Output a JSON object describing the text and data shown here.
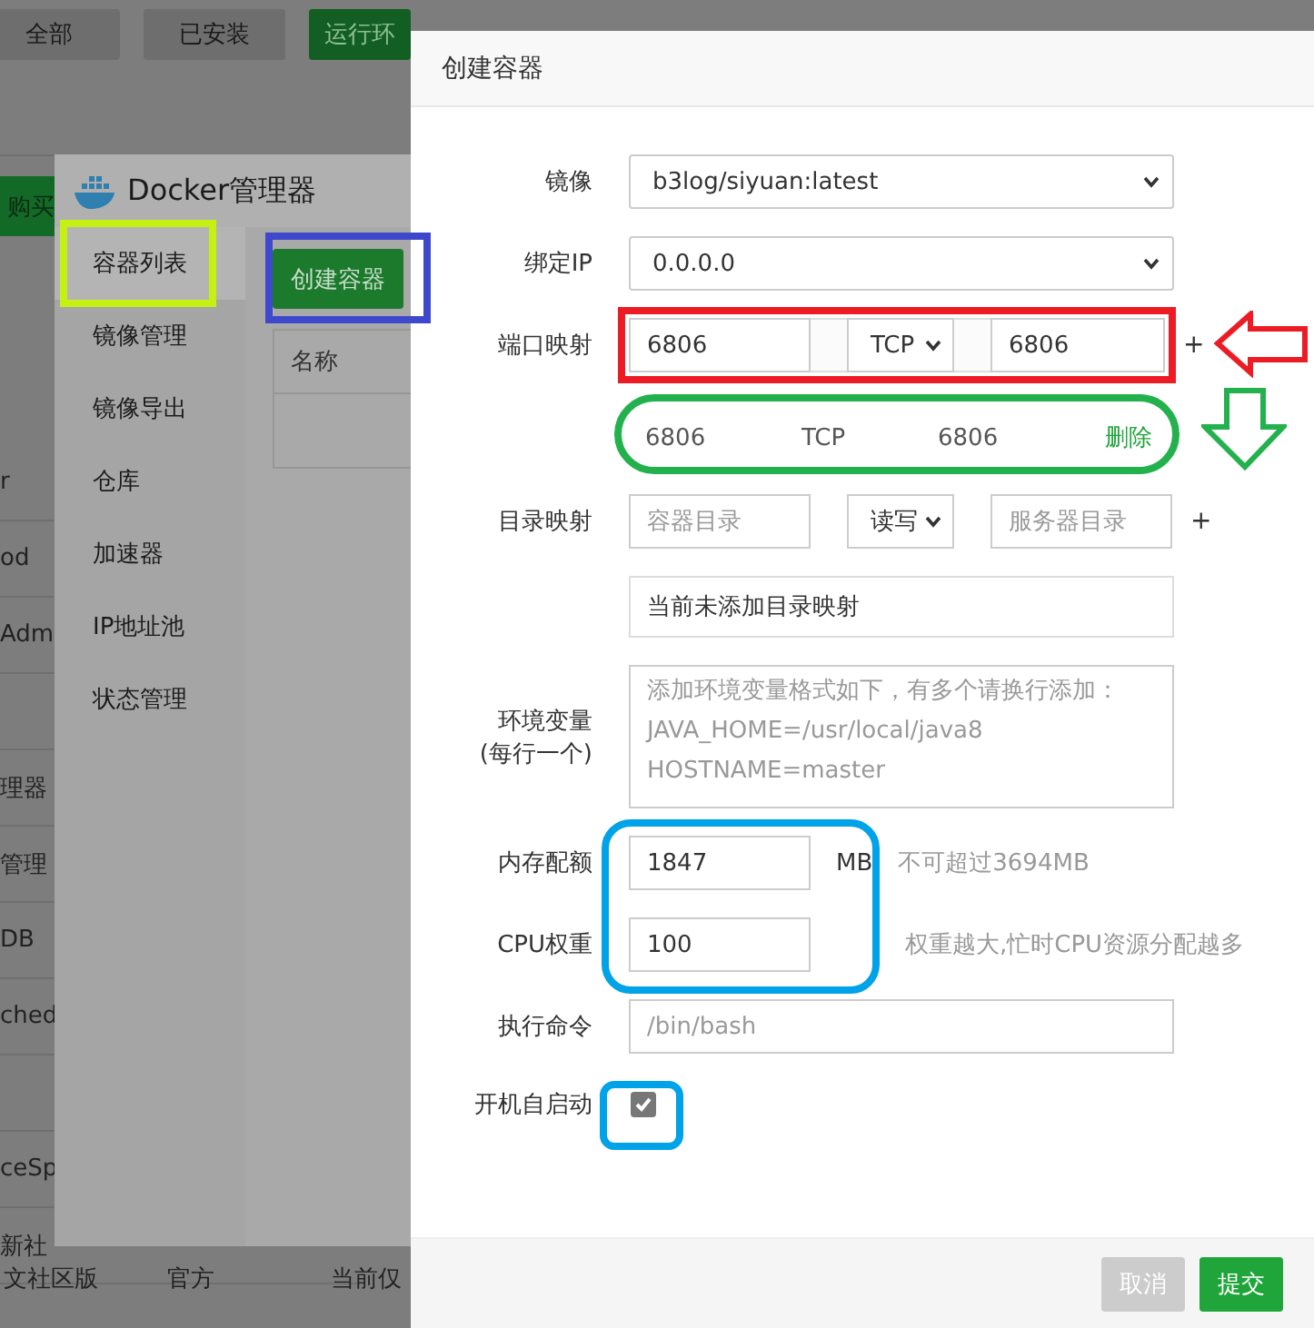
{
  "background_page": {
    "tabs": [
      {
        "label": "全部",
        "selected": false
      },
      {
        "label": "已安装",
        "selected": false
      },
      {
        "label": "运行环",
        "selected": true
      }
    ],
    "buy_button": "购买",
    "list_rows": [
      "r",
      "od",
      "Adm",
      "",
      "理器",
      "管理",
      "DB",
      "ched",
      "",
      "ceSp",
      "新社"
    ],
    "footer_cells": [
      "文社区版",
      "官方",
      "当前仅"
    ]
  },
  "docker_window": {
    "title": "Docker管理器",
    "sidebar": [
      {
        "label": "容器列表",
        "selected": true
      },
      {
        "label": "镜像管理",
        "selected": false
      },
      {
        "label": "镜像导出",
        "selected": false
      },
      {
        "label": "仓库",
        "selected": false
      },
      {
        "label": "加速器",
        "selected": false
      },
      {
        "label": "IP地址池",
        "selected": false
      },
      {
        "label": "状态管理",
        "selected": false
      }
    ],
    "create_button": "创建容器",
    "table_columns": [
      "名称"
    ]
  },
  "dialog": {
    "title": "创建容器",
    "form": [
      {
        "kind": "select",
        "label": "镜像",
        "value": "b3log/siyuan:latest"
      },
      {
        "kind": "select",
        "label": "绑定IP",
        "value": "0.0.0.0"
      },
      {
        "kind": "port",
        "label": "端口映射",
        "left": {
          "value": "6806"
        },
        "protocol": "TCP",
        "right": {
          "value": "6806"
        },
        "add": "+"
      },
      {
        "kind": "mapping",
        "cells": [
          "6806",
          "TCP",
          "6806"
        ],
        "action": "删除"
      },
      {
        "kind": "dir",
        "label": "目录映射",
        "left": {
          "placeholder": "容器目录"
        },
        "protocol": "读写",
        "right": {
          "placeholder": "服务器目录"
        },
        "add": "+"
      },
      {
        "kind": "note",
        "text": "当前未添加目录映射"
      },
      {
        "kind": "textarea",
        "label": "环境变量",
        "sublabel": "(每行一个)",
        "placeholder": "添加环境变量格式如下，有多个请换行添加：\nJAVA_HOME=/usr/local/java8\nHOSTNAME=master"
      },
      {
        "kind": "input",
        "label": "内存配额",
        "value": "1847",
        "unit": "MB",
        "hint": "不可超过3694MB"
      },
      {
        "kind": "input",
        "label": "CPU权重",
        "value": "100",
        "hint": "权重越大,忙时CPU资源分配越多"
      },
      {
        "kind": "input",
        "label": "执行命令",
        "placeholder": "/bin/bash"
      },
      {
        "kind": "checkbox",
        "label": "开机自启动",
        "checked": true
      }
    ],
    "buttons": [
      {
        "label": "取消",
        "disabled": true
      },
      {
        "label": "提交",
        "disabled": false
      }
    ]
  }
}
